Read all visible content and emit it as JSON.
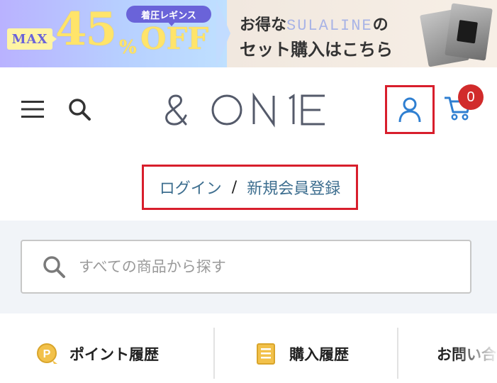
{
  "banner": {
    "max_label": "MAX",
    "discount_number": "45",
    "discount_percent": "%",
    "discount_off": "OFF",
    "category_label": "着圧レギンス",
    "line1_prefix": "お得な",
    "line1_brand": "SULALINE",
    "line1_suffix": "の",
    "line2": "セット購入はこちら"
  },
  "header": {
    "menu_icon": "hamburger-menu-icon",
    "search_icon": "search-icon",
    "logo_text": "& ONE",
    "account_icon": "user-icon",
    "cart_icon": "cart-icon",
    "cart_count": "0"
  },
  "auth": {
    "login_label": "ログイン",
    "separator": "/",
    "register_label": "新規会員登録"
  },
  "search": {
    "placeholder": "すべての商品から探す"
  },
  "quick_links": [
    {
      "label": "ポイント履歴",
      "icon": "point-coin-icon"
    },
    {
      "label": "購入履歴",
      "icon": "receipt-icon"
    },
    {
      "label": "お問い合",
      "icon": ""
    }
  ],
  "colors": {
    "link": "#3d6e8f",
    "accent_blue": "#2f7fd1",
    "highlight_red": "#d81e2c",
    "badge_red": "#d12b2b",
    "search_bg": "#f1f4f8"
  }
}
